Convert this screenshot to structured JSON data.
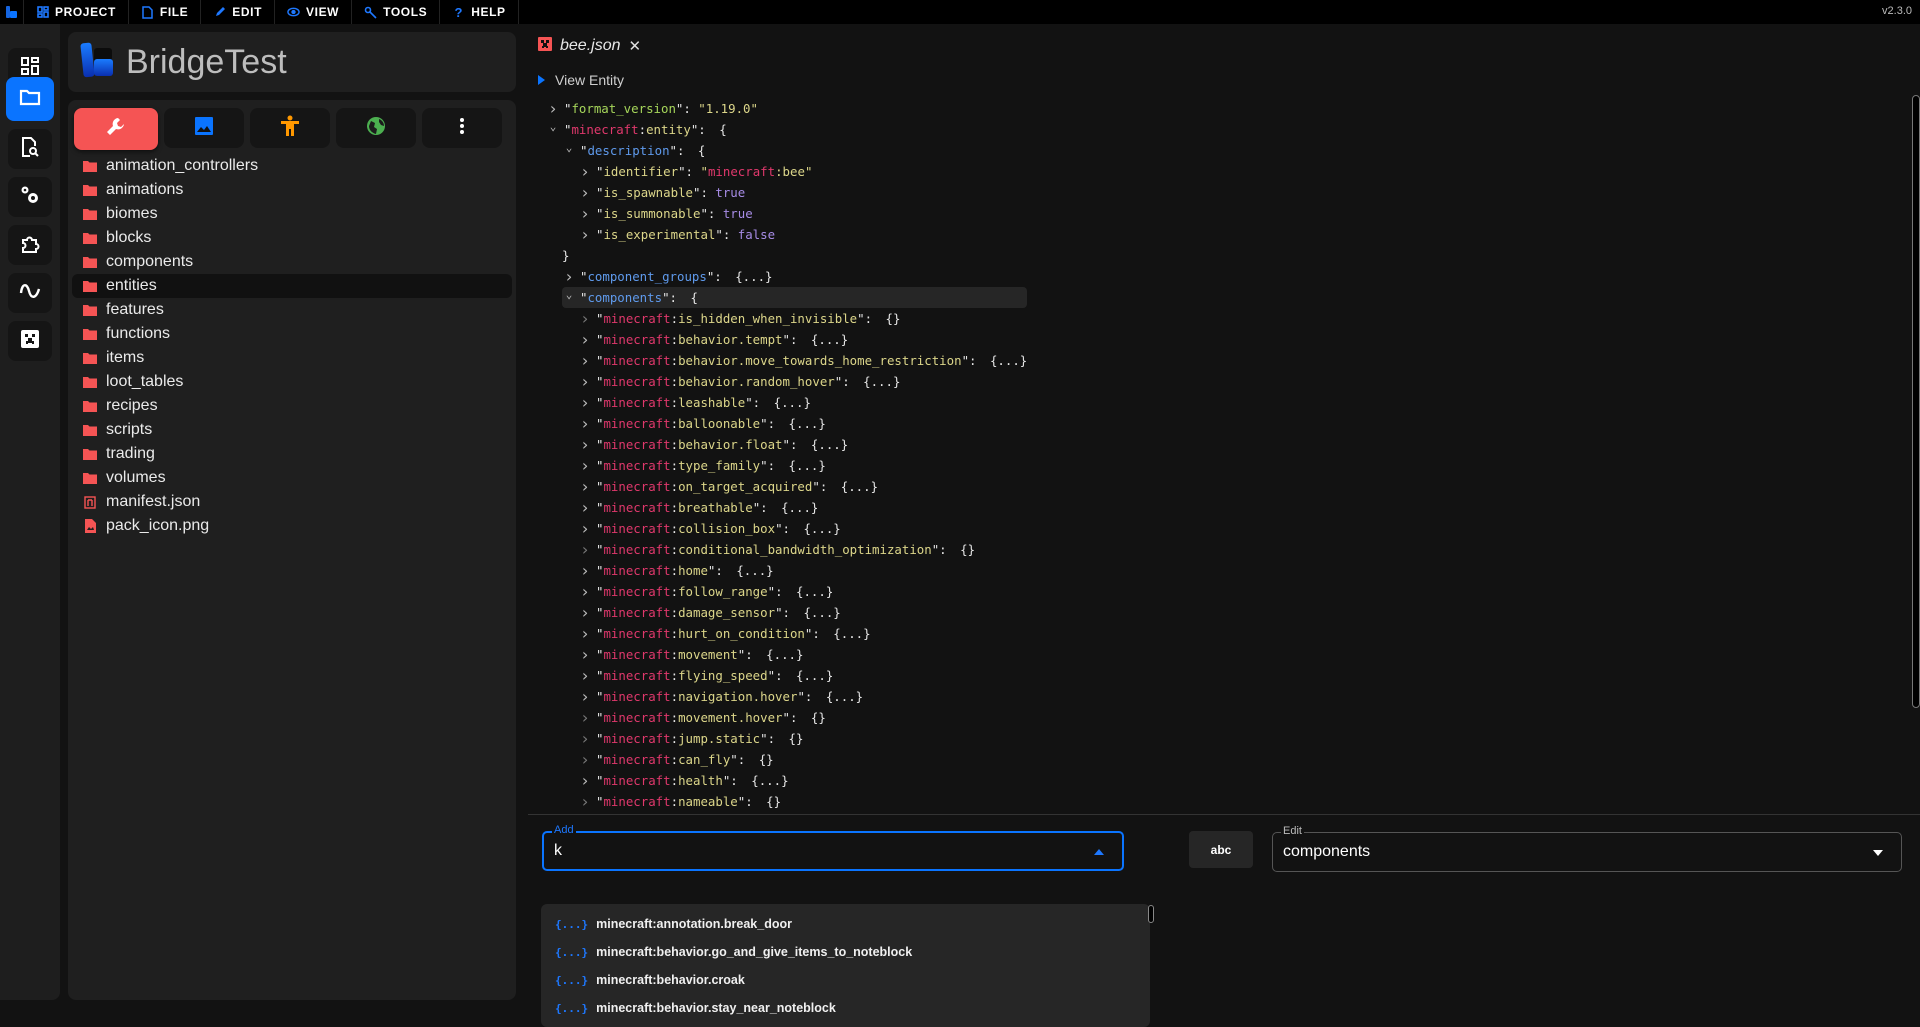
{
  "menubar": {
    "items": [
      {
        "label": "PROJECT",
        "icon": "dashboard-icon"
      },
      {
        "label": "FILE",
        "icon": "file-icon"
      },
      {
        "label": "EDIT",
        "icon": "pencil-icon"
      },
      {
        "label": "VIEW",
        "icon": "eye-icon"
      },
      {
        "label": "TOOLS",
        "icon": "wrench-icon"
      },
      {
        "label": "HELP",
        "icon": "help-icon"
      }
    ],
    "version": "v2.3.0"
  },
  "sidebar": {
    "items": [
      {
        "name": "dashboard",
        "icon": "dashboard-icon",
        "active": false
      },
      {
        "name": "file-explorer",
        "icon": "folder-icon",
        "active": true
      },
      {
        "name": "file-search",
        "icon": "file-search-icon",
        "active": false
      },
      {
        "name": "settings",
        "icon": "cogs-icon",
        "active": false
      },
      {
        "name": "extensions",
        "icon": "puzzle-icon",
        "active": false
      },
      {
        "name": "molang",
        "icon": "wave-icon",
        "active": false
      },
      {
        "name": "minecraft",
        "icon": "creeper-icon",
        "active": false
      }
    ]
  },
  "project": {
    "title": "BridgeTest"
  },
  "pack_tabs": [
    {
      "name": "behavior-pack",
      "icon": "wrench-icon",
      "color": "#ffffff",
      "bg": "#f55454",
      "active": true
    },
    {
      "name": "resource-pack",
      "icon": "image-icon",
      "color": "#0a74ff",
      "active": false
    },
    {
      "name": "skin-pack",
      "icon": "person-icon",
      "color": "#ff9800",
      "active": false
    },
    {
      "name": "world-template",
      "icon": "globe-icon",
      "color": "#4caf50",
      "active": false
    },
    {
      "name": "more",
      "icon": "more-vertical-icon",
      "color": "#ffffff",
      "active": false
    }
  ],
  "files": [
    {
      "label": "animation_controllers",
      "type": "folder"
    },
    {
      "label": "animations",
      "type": "folder"
    },
    {
      "label": "biomes",
      "type": "folder"
    },
    {
      "label": "blocks",
      "type": "folder"
    },
    {
      "label": "components",
      "type": "folder"
    },
    {
      "label": "entities",
      "type": "folder",
      "selected": true
    },
    {
      "label": "features",
      "type": "folder"
    },
    {
      "label": "functions",
      "type": "folder"
    },
    {
      "label": "items",
      "type": "folder"
    },
    {
      "label": "loot_tables",
      "type": "folder"
    },
    {
      "label": "recipes",
      "type": "folder"
    },
    {
      "label": "scripts",
      "type": "folder"
    },
    {
      "label": "trading",
      "type": "folder"
    },
    {
      "label": "volumes",
      "type": "folder"
    },
    {
      "label": "manifest.json",
      "type": "manifest"
    },
    {
      "label": "pack_icon.png",
      "type": "image"
    }
  ],
  "editor": {
    "tab": {
      "name": "bee.json",
      "icon": "creeper-icon",
      "close": "✕"
    },
    "view_entity_label": "View Entity",
    "tree": [
      {
        "indent": 0,
        "chev": "right",
        "key": "format_version",
        "keyColor": "green",
        "value": "\"1.19.0\"",
        "valueType": "str"
      },
      {
        "indent": 0,
        "chev": "down",
        "ns": "minecraft",
        "key": "entity",
        "keyColor": "yellow",
        "value": "{",
        "valueType": "p"
      },
      {
        "indent": 1,
        "chev": "down",
        "key": "description",
        "keyColor": "blue",
        "value": "{",
        "valueType": "p"
      },
      {
        "indent": 2,
        "chev": "right",
        "key": "identifier",
        "keyColor": "yellow",
        "valueNs": "minecraft",
        "value": "bee",
        "valueType": "nsstr"
      },
      {
        "indent": 2,
        "chev": "right",
        "key": "is_spawnable",
        "keyColor": "yellow",
        "value": "true",
        "valueType": "bool"
      },
      {
        "indent": 2,
        "chev": "right",
        "key": "is_summonable",
        "keyColor": "yellow",
        "value": "true",
        "valueType": "bool"
      },
      {
        "indent": 2,
        "chev": "right",
        "key": "is_experimental",
        "keyColor": "yellow",
        "value": "false",
        "valueType": "bool"
      },
      {
        "indent": 1,
        "chev": "none",
        "raw": "}"
      },
      {
        "indent": 1,
        "chev": "right",
        "key": "component_groups",
        "keyColor": "blue",
        "value": "{...}",
        "valueType": "p"
      },
      {
        "indent": 1,
        "chev": "down",
        "key": "components",
        "keyColor": "blue",
        "value": "{",
        "valueType": "p",
        "highlight": true
      },
      {
        "indent": 2,
        "chev": "dim",
        "ns": "minecraft",
        "key": "is_hidden_when_invisible",
        "keyColor": "yellow",
        "value": "{}",
        "valueType": "p"
      },
      {
        "indent": 2,
        "chev": "right",
        "ns": "minecraft",
        "key": "behavior.tempt",
        "keyColor": "yellow",
        "value": "{...}",
        "valueType": "p"
      },
      {
        "indent": 2,
        "chev": "right",
        "ns": "minecraft",
        "key": "behavior.move_towards_home_restriction",
        "keyColor": "yellow",
        "value": "{...}",
        "valueType": "p"
      },
      {
        "indent": 2,
        "chev": "right",
        "ns": "minecraft",
        "key": "behavior.random_hover",
        "keyColor": "yellow",
        "value": "{...}",
        "valueType": "p"
      },
      {
        "indent": 2,
        "chev": "right",
        "ns": "minecraft",
        "key": "leashable",
        "keyColor": "yellow",
        "value": "{...}",
        "valueType": "p"
      },
      {
        "indent": 2,
        "chev": "right",
        "ns": "minecraft",
        "key": "balloonable",
        "keyColor": "yellow",
        "value": "{...}",
        "valueType": "p"
      },
      {
        "indent": 2,
        "chev": "right",
        "ns": "minecraft",
        "key": "behavior.float",
        "keyColor": "yellow",
        "value": "{...}",
        "valueType": "p"
      },
      {
        "indent": 2,
        "chev": "right",
        "ns": "minecraft",
        "key": "type_family",
        "keyColor": "yellow",
        "value": "{...}",
        "valueType": "p"
      },
      {
        "indent": 2,
        "chev": "right",
        "ns": "minecraft",
        "key": "on_target_acquired",
        "keyColor": "yellow",
        "value": "{...}",
        "valueType": "p"
      },
      {
        "indent": 2,
        "chev": "right",
        "ns": "minecraft",
        "key": "breathable",
        "keyColor": "yellow",
        "value": "{...}",
        "valueType": "p"
      },
      {
        "indent": 2,
        "chev": "right",
        "ns": "minecraft",
        "key": "collision_box",
        "keyColor": "yellow",
        "value": "{...}",
        "valueType": "p"
      },
      {
        "indent": 2,
        "chev": "dim",
        "ns": "minecraft",
        "key": "conditional_bandwidth_optimization",
        "keyColor": "yellow",
        "value": "{}",
        "valueType": "p"
      },
      {
        "indent": 2,
        "chev": "right",
        "ns": "minecraft",
        "key": "home",
        "keyColor": "yellow",
        "value": "{...}",
        "valueType": "p"
      },
      {
        "indent": 2,
        "chev": "right",
        "ns": "minecraft",
        "key": "follow_range",
        "keyColor": "yellow",
        "value": "{...}",
        "valueType": "p"
      },
      {
        "indent": 2,
        "chev": "right",
        "ns": "minecraft",
        "key": "damage_sensor",
        "keyColor": "yellow",
        "value": "{...}",
        "valueType": "p"
      },
      {
        "indent": 2,
        "chev": "right",
        "ns": "minecraft",
        "key": "hurt_on_condition",
        "keyColor": "yellow",
        "value": "{...}",
        "valueType": "p"
      },
      {
        "indent": 2,
        "chev": "right",
        "ns": "minecraft",
        "key": "movement",
        "keyColor": "yellow",
        "value": "{...}",
        "valueType": "p"
      },
      {
        "indent": 2,
        "chev": "right",
        "ns": "minecraft",
        "key": "flying_speed",
        "keyColor": "yellow",
        "value": "{...}",
        "valueType": "p"
      },
      {
        "indent": 2,
        "chev": "right",
        "ns": "minecraft",
        "key": "navigation.hover",
        "keyColor": "yellow",
        "value": "{...}",
        "valueType": "p"
      },
      {
        "indent": 2,
        "chev": "dim",
        "ns": "minecraft",
        "key": "movement.hover",
        "keyColor": "yellow",
        "value": "{}",
        "valueType": "p"
      },
      {
        "indent": 2,
        "chev": "dim",
        "ns": "minecraft",
        "key": "jump.static",
        "keyColor": "yellow",
        "value": "{}",
        "valueType": "p"
      },
      {
        "indent": 2,
        "chev": "dim",
        "ns": "minecraft",
        "key": "can_fly",
        "keyColor": "yellow",
        "value": "{}",
        "valueType": "p"
      },
      {
        "indent": 2,
        "chev": "right",
        "ns": "minecraft",
        "key": "health",
        "keyColor": "yellow",
        "value": "{...}",
        "valueType": "p"
      },
      {
        "indent": 2,
        "chev": "dim",
        "ns": "minecraft",
        "key": "nameable",
        "keyColor": "yellow",
        "value": "{}",
        "valueType": "p"
      }
    ]
  },
  "bottom": {
    "add": {
      "legend": "Add",
      "value": "k"
    },
    "suggestions": [
      {
        "icon": "{...}",
        "label": "minecraft:annotation.break_door"
      },
      {
        "icon": "{...}",
        "label": "minecraft:behavior.go_and_give_items_to_noteblock"
      },
      {
        "icon": "{...}",
        "label": "minecraft:behavior.croak"
      },
      {
        "icon": "{...}",
        "label": "minecraft:behavior.stay_near_noteblock"
      }
    ],
    "abc_label": "abc",
    "edit": {
      "legend": "Edit",
      "value": "components"
    }
  },
  "colors": {
    "accent": "#0a74ff",
    "behavior_pack": "#f55454",
    "namespace": "#e0386c",
    "key": "#dcd68a",
    "bool": "#a78ce6"
  }
}
